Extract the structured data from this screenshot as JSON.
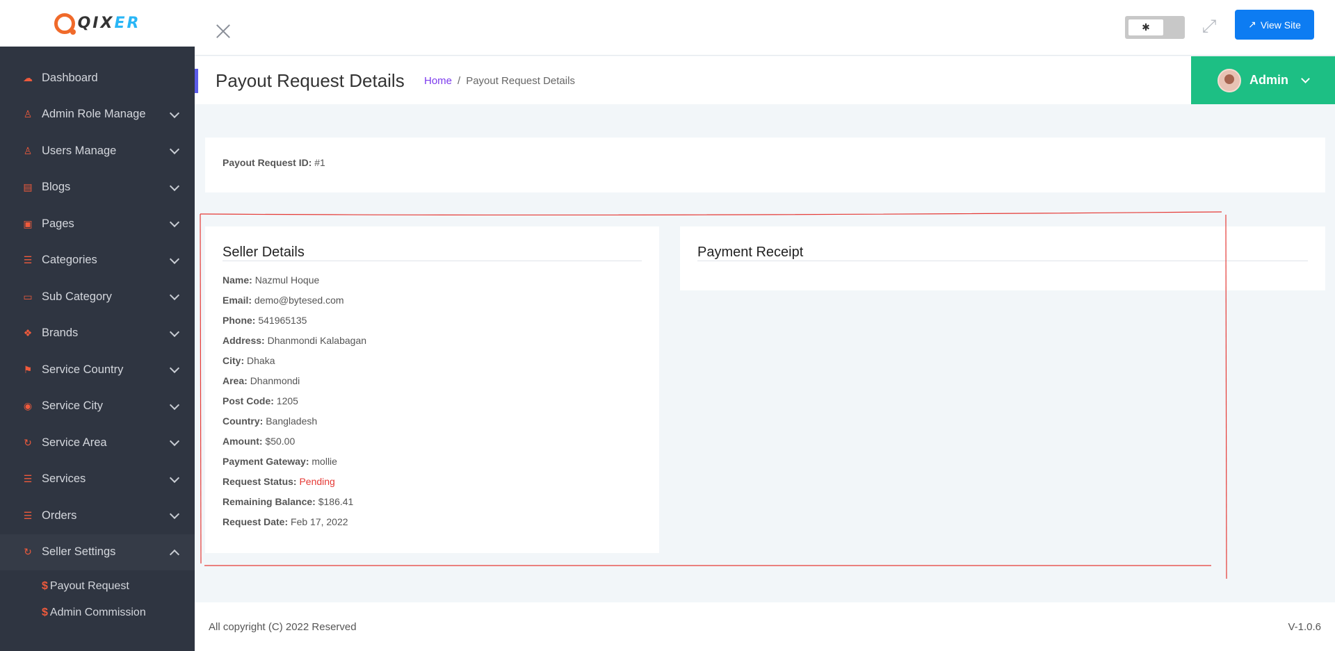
{
  "brand": {
    "name_main": "QIX",
    "name_accent": "ER"
  },
  "sidebar": {
    "items": [
      {
        "label": "Dashboard",
        "icon": "dashboard-icon",
        "glyph": "☁",
        "has_children": false
      },
      {
        "label": "Admin Role Manage",
        "icon": "user-icon",
        "glyph": "♙",
        "has_children": true
      },
      {
        "label": "Users Manage",
        "icon": "user-icon",
        "glyph": "♙",
        "has_children": true
      },
      {
        "label": "Blogs",
        "icon": "comment-icon",
        "glyph": "▤",
        "has_children": true
      },
      {
        "label": "Pages",
        "icon": "pages-icon",
        "glyph": "▣",
        "has_children": true
      },
      {
        "label": "Categories",
        "icon": "list-icon",
        "glyph": "☰",
        "has_children": true
      },
      {
        "label": "Sub Category",
        "icon": "card-icon",
        "glyph": "▭",
        "has_children": true
      },
      {
        "label": "Brands",
        "icon": "dropbox-icon",
        "glyph": "❖",
        "has_children": true
      },
      {
        "label": "Service Country",
        "icon": "flag-icon",
        "glyph": "⚑",
        "has_children": true
      },
      {
        "label": "Service City",
        "icon": "circle-arrow-icon",
        "glyph": "◉",
        "has_children": true
      },
      {
        "label": "Service Area",
        "icon": "refresh-icon",
        "glyph": "↻",
        "has_children": true
      },
      {
        "label": "Services",
        "icon": "list-icon",
        "glyph": "☰",
        "has_children": true
      },
      {
        "label": "Orders",
        "icon": "list-icon",
        "glyph": "☰",
        "has_children": true
      },
      {
        "label": "Seller Settings",
        "icon": "refresh-icon",
        "glyph": "↻",
        "has_children": true,
        "open": true
      }
    ],
    "submenu": [
      {
        "label": "Payout Request",
        "glyph": "$"
      },
      {
        "label": "Admin Commission",
        "glyph": "$"
      }
    ]
  },
  "topbar": {
    "toggle_glyph": "✱",
    "expand_glyph": "⤢",
    "view_site_label": "View Site"
  },
  "header": {
    "title": "Payout Request Details",
    "breadcrumb_home": "Home",
    "breadcrumb_sep": "/",
    "breadcrumb_current": "Payout Request Details",
    "admin_name": "Admin"
  },
  "request": {
    "id_label": "Payout Request ID:",
    "id_value": "#1"
  },
  "seller": {
    "title": "Seller Details",
    "fields": [
      {
        "label": "Name:",
        "value": "Nazmul Hoque"
      },
      {
        "label": "Email:",
        "value": "demo@bytesed.com"
      },
      {
        "label": "Phone:",
        "value": "541965135"
      },
      {
        "label": "Address:",
        "value": "Dhanmondi Kalabagan"
      },
      {
        "label": "City:",
        "value": "Dhaka"
      },
      {
        "label": "Area:",
        "value": "Dhanmondi"
      },
      {
        "label": "Post Code:",
        "value": "1205"
      },
      {
        "label": "Country:",
        "value": "Bangladesh"
      },
      {
        "label": "Amount:",
        "value": "$50.00"
      },
      {
        "label": "Payment Gateway:",
        "value": "mollie"
      },
      {
        "label": "Request Status:",
        "value": "Pending",
        "status": "pending"
      },
      {
        "label": "Remaining Balance:",
        "value": "$186.41"
      },
      {
        "label": "Request Date:",
        "value": "Feb 17, 2022"
      }
    ]
  },
  "receipt": {
    "title": "Payment Receipt"
  },
  "footer": {
    "copyright": "All copyright (C) 2022 Reserved",
    "version": "V-1.0.6"
  },
  "colors": {
    "sidebar_bg": "#2f3541",
    "accent_orange": "#ef5a3c",
    "admin_green": "#1dbf84",
    "view_site_blue": "#0d7cf2",
    "breadcrumb_link": "#7c3aed",
    "status_pending": "#e53935",
    "annotation_red": "#e53935"
  }
}
